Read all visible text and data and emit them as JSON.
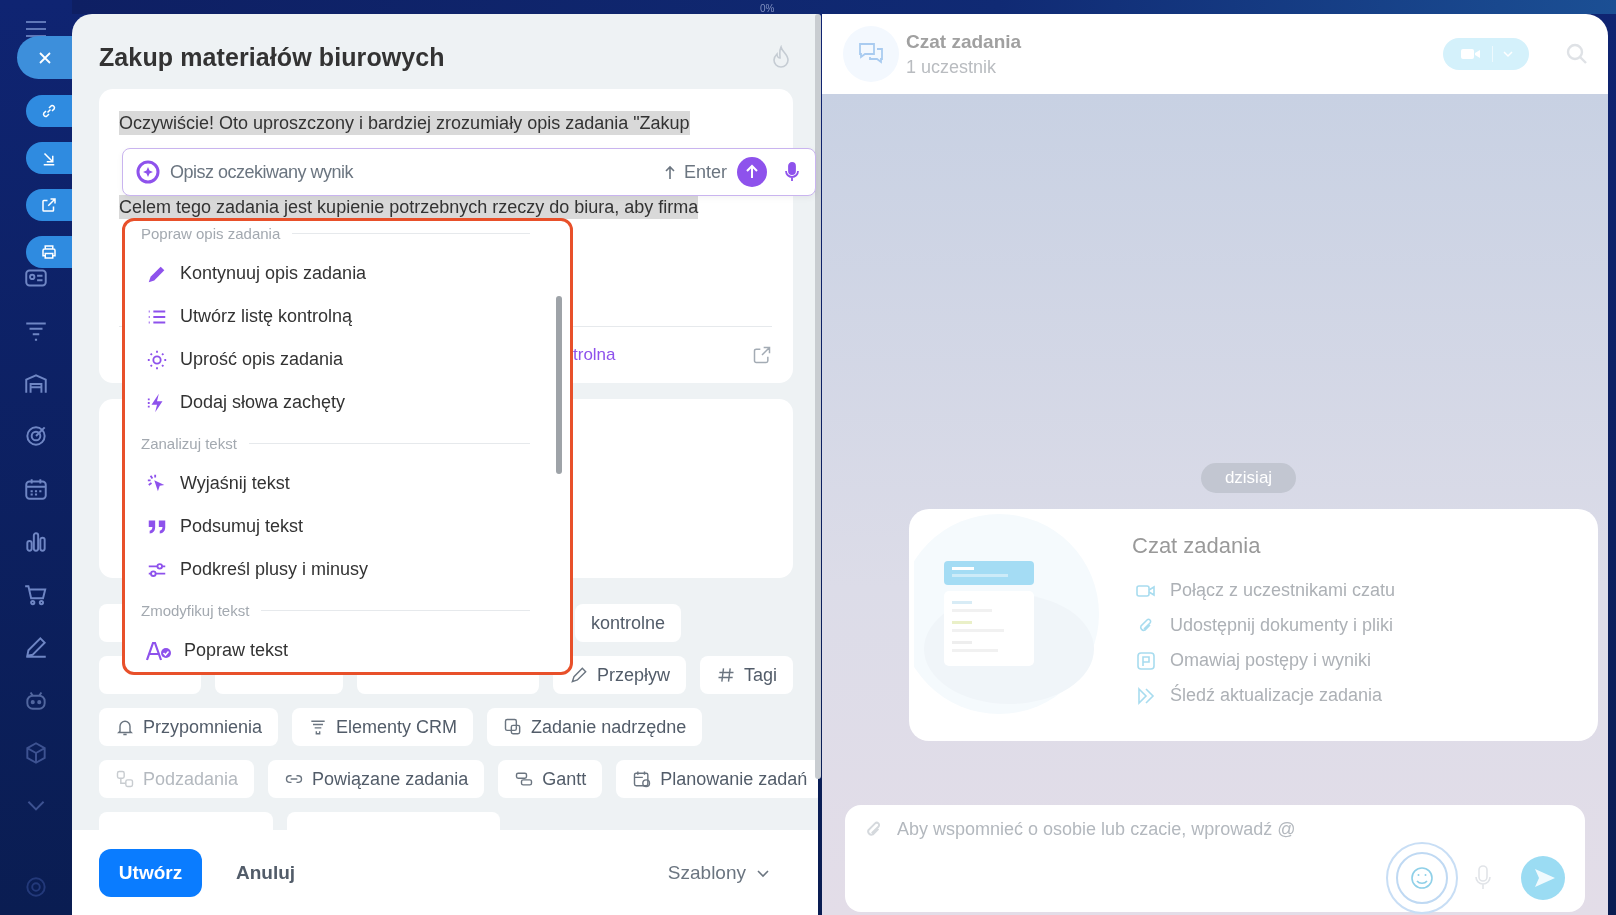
{
  "top_bar": {
    "progress": "0%"
  },
  "task": {
    "title": "Zakup materiałów biurowych",
    "description_lines": [
      "Oczywiście! Oto uproszczony i bardziej zrozumiały opis zadania \"Zakup",
      "Celem tego zadania jest kupienie potrzebnych rzeczy do biura, aby firma"
    ],
    "checklist_link": "trolna"
  },
  "ai_prompt": {
    "placeholder": "Opisz oczekiwany wynik",
    "enter_hint": "Enter"
  },
  "ai_menu": {
    "sections": [
      {
        "title": "Popraw opis zadania",
        "items": [
          "Kontynuuj opis zadania",
          "Utwórz listę kontrolną",
          "Uprość opis zadania",
          "Dodaj słowa zachęty"
        ]
      },
      {
        "title": "Zanalizuj tekst",
        "items": [
          "Wyjaśnij tekst",
          "Podsumuj tekst",
          "Podkreśl plusy i minusy"
        ]
      },
      {
        "title": "Zmodyfikuj tekst",
        "items": [
          "Popraw tekst"
        ]
      }
    ]
  },
  "chip_rows": [
    [
      {
        "kind": "blank"
      },
      {
        "kind": "plain",
        "label": "kontrolne",
        "disabled": false
      }
    ],
    [
      {
        "kind": "blank"
      },
      {
        "kind": "blank"
      },
      {
        "kind": "blank"
      },
      {
        "kind": "flow",
        "label": "Przepływ",
        "disabled": false
      },
      {
        "kind": "hash",
        "label": "Tagi",
        "disabled": false
      }
    ],
    [
      {
        "kind": "bell",
        "label": "Przypomnienia",
        "disabled": false
      },
      {
        "kind": "funnel",
        "label": "Elementy CRM",
        "disabled": false
      },
      {
        "kind": "parent",
        "label": "Zadanie nadrzędne",
        "disabled": false
      }
    ],
    [
      {
        "kind": "subtasks",
        "label": "Podzadania",
        "disabled": true
      },
      {
        "kind": "link",
        "label": "Powiązane zadania",
        "disabled": false
      },
      {
        "kind": "gantt",
        "label": "Gantt",
        "disabled": false
      },
      {
        "kind": "calendar",
        "label": "Planowanie zadań",
        "disabled": false
      }
    ],
    [
      {
        "kind": "blank"
      },
      {
        "kind": "blank"
      }
    ]
  ],
  "footer": {
    "create": "Utwórz",
    "cancel": "Anuluj",
    "templates": "Szablony"
  },
  "chat": {
    "title": "Czat zadania",
    "subtitle": "1 uczestnik",
    "date_label": "dzisiaj",
    "welcome": {
      "title": "Czat zadania",
      "features": [
        "Połącz z uczestnikami czatu",
        "Udostępnij dokumenty i pliki",
        "Omawiaj postępy i wyniki",
        "Śledź aktualizacje zadania"
      ]
    },
    "input": {
      "placeholder": "Aby wspomnieć o osobie lub czacie, wprowadź @"
    }
  }
}
